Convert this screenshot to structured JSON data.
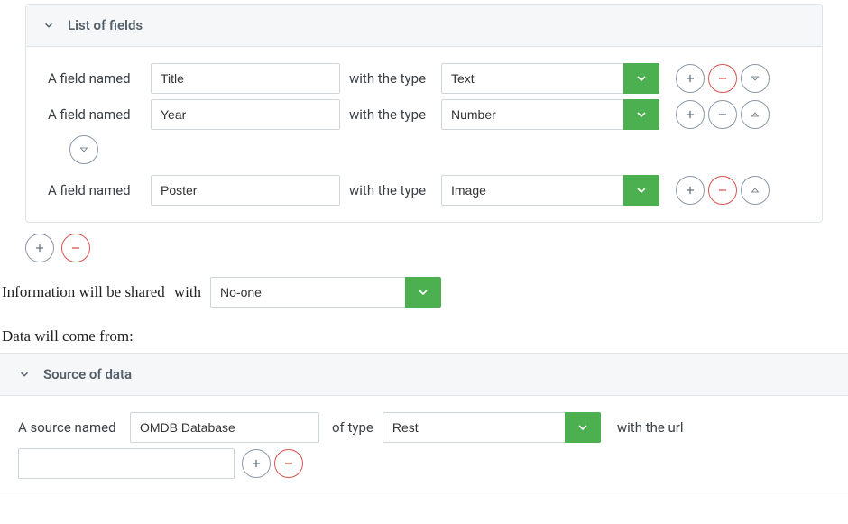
{
  "fields_panel": {
    "title": "List of fields",
    "field_named_label": "A field named",
    "with_type_label": "with the type",
    "rows": [
      {
        "name": "Title",
        "type": "Text"
      },
      {
        "name": "Year",
        "type": "Number"
      },
      {
        "name": "Poster",
        "type": "Image"
      }
    ]
  },
  "share": {
    "prefix": "Information will be shared",
    "with_label": "with",
    "value": "No-one"
  },
  "data_from_label": "Data will come from:",
  "source_panel": {
    "title": "Source of data",
    "source_named_label": "A source named",
    "of_type_label": "of type",
    "with_url_label": "with the url",
    "source_name": "OMDB Database",
    "source_type": "Rest",
    "url_value": ""
  }
}
